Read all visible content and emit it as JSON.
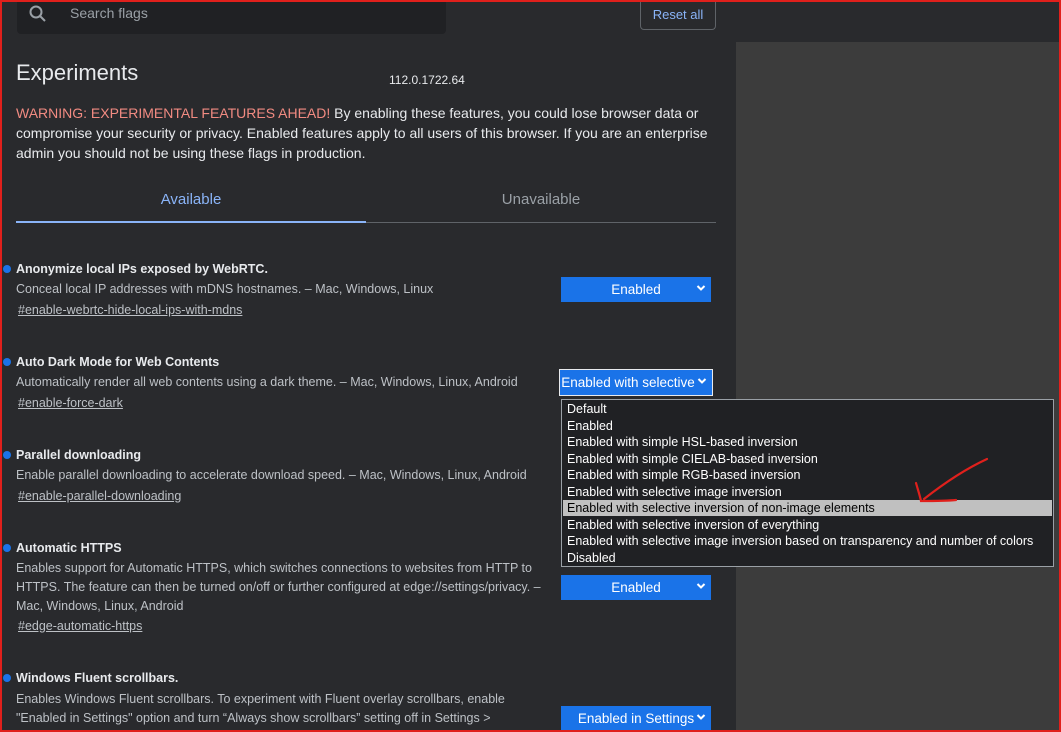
{
  "search": {
    "placeholder": "Search flags"
  },
  "reset_label": "Reset all",
  "page_title": "Experiments",
  "version": "112.0.1722.64",
  "warning": {
    "prefix": "WARNING: EXPERIMENTAL FEATURES AHEAD!",
    "text": " By enabling these features, you could lose browser data or compromise your security or privacy. Enabled features apply to all users of this browser. If you are an enterprise admin you should not be using these flags in production."
  },
  "tabs": [
    {
      "label": "Available",
      "active": true
    },
    {
      "label": "Unavailable",
      "active": false
    }
  ],
  "flags": [
    {
      "name": "Anonymize local IPs exposed by WebRTC.",
      "description": "Conceal local IP addresses with mDNS hostnames. – Mac, Windows, Linux",
      "anchor": "#enable-webrtc-hide-local-ips-with-mdns",
      "value": "Enabled"
    },
    {
      "name": "Auto Dark Mode for Web Contents",
      "description": "Automatically render all web contents using a dark theme. – Mac, Windows, Linux, Android",
      "anchor": "#enable-force-dark",
      "value": "Enabled with selective"
    },
    {
      "name": "Parallel downloading",
      "description": "Enable parallel downloading to accelerate download speed. – Mac, Windows, Linux, Android",
      "anchor": "#enable-parallel-downloading",
      "value": ""
    },
    {
      "name": "Automatic HTTPS",
      "description": "Enables support for Automatic HTTPS, which switches connections to websites from HTTP to HTTPS. The feature can then be turned on/off or further configured at edge://settings/privacy. – Mac, Windows, Linux, Android",
      "anchor": "#edge-automatic-https",
      "value": "Enabled"
    },
    {
      "name": "Windows Fluent scrollbars.",
      "description": "Enables Windows Fluent scrollbars. To experiment with Fluent overlay scrollbars, enable \"Enabled in Settings\" option and turn “Always show scrollbars” setting off in Settings >",
      "anchor": "",
      "value": "Enabled in Settings"
    }
  ],
  "dropdown": {
    "options": [
      "Default",
      "Enabled",
      "Enabled with simple HSL-based inversion",
      "Enabled with simple CIELAB-based inversion",
      "Enabled with simple RGB-based inversion",
      "Enabled with selective image inversion",
      "Enabled with selective inversion of non-image elements",
      "Enabled with selective inversion of everything",
      "Enabled with selective image inversion based on transparency and number of colors",
      "Disabled"
    ],
    "highlighted_index": 6
  },
  "colors": {
    "background": "#292a2d",
    "accent": "#1a73e8",
    "link": "#8ab4f8",
    "warning": "#f28b82",
    "annotation": "#e0201c"
  }
}
